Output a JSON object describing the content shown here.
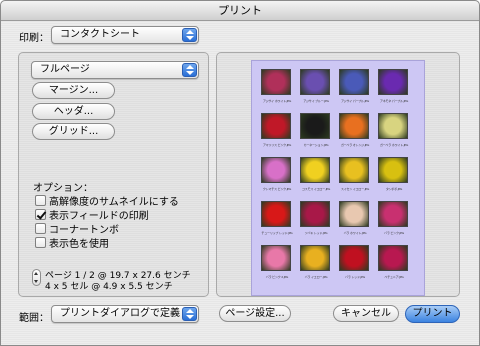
{
  "window": {
    "title": "プリント"
  },
  "printer": {
    "label": "印刷：",
    "value": "コンタクトシート"
  },
  "layout": {
    "page_popup": "フルページ",
    "margin_button": "マージン...",
    "header_button": "ヘッダ...",
    "grid_button": "グリッド..."
  },
  "options": {
    "heading": "オプション：",
    "items": [
      {
        "label": "高解像度のサムネイルにする",
        "checked": false
      },
      {
        "label": "表示フィールドの印刷",
        "checked": true
      },
      {
        "label": "コーナートンボ",
        "checked": false
      },
      {
        "label": "表示色を使用",
        "checked": false
      }
    ]
  },
  "page_info": {
    "line1": "ページ 1 / 2 @ 19.7 x 27.6 センチ",
    "line2": "4 x 5 セル @ 4.9 x 5.5 センチ"
  },
  "footer": {
    "range_label": "範囲：",
    "range_value": "プリントダイアログで定義",
    "page_setup": "ページ設定...",
    "cancel": "キャンセル",
    "print": "プリント"
  },
  "preview": {
    "sheet_color": "#cdc7f4",
    "photos": [
      {
        "color": "#b0305a",
        "caption": "アジサイ ホワイト.JPG"
      },
      {
        "color": "#6a4fb0",
        "caption": "アジサイ ブルー.JPG"
      },
      {
        "color": "#4a5ab8",
        "caption": "アジサイ パープル.JPG"
      },
      {
        "color": "#6a2ab0",
        "caption": "アネモネ パープル.JPG"
      },
      {
        "color": "#c01828",
        "caption": "アマリリス ピンク.JPG"
      },
      {
        "color": "#1a1a1a",
        "caption": "カーネーション.JPG"
      },
      {
        "color": "#e87020",
        "caption": "ガーベラ オレンジ.JPG"
      },
      {
        "color": "#d8d480",
        "caption": "ガーベラ ホワイト.JPG"
      },
      {
        "color": "#d870c8",
        "caption": "クレマチス ピンク.JPG"
      },
      {
        "color": "#f0d020",
        "caption": "コスモス イエロー.JPG"
      },
      {
        "color": "#e8c020",
        "caption": "スイセン イエロー.JPG"
      },
      {
        "color": "#d8c010",
        "caption": "タンポポ.JPG"
      },
      {
        "color": "#d81818",
        "caption": "チューリップ レッド.JPG"
      },
      {
        "color": "#a81848",
        "caption": "ツバキ レッド.JPG"
      },
      {
        "color": "#e8c8b0",
        "caption": "バラ ホワイト.JPG"
      },
      {
        "color": "#c83070",
        "caption": "バラ ピンク.JPG"
      },
      {
        "color": "#e878a8",
        "caption": "バラ ピンク 2.JPG"
      },
      {
        "color": "#e8b020",
        "caption": "バラ イエロー.JPG"
      },
      {
        "color": "#c01020",
        "caption": "バラ レッド.JPG"
      },
      {
        "color": "#b81850",
        "caption": "ペチュニア.JPG"
      }
    ]
  }
}
